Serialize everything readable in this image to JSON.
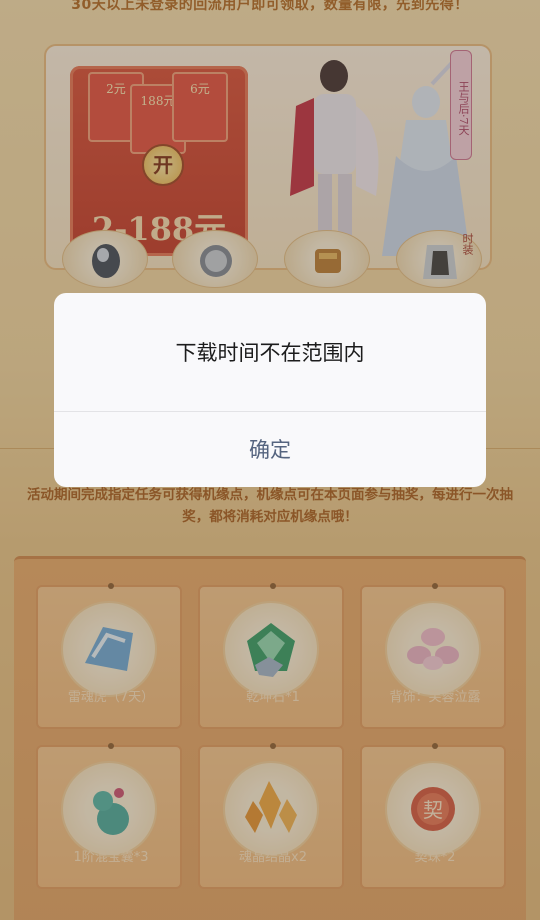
{
  "page": {
    "top_notice": "30天以上未登录的回流用户即可领取，数量有限，先到先得！",
    "banner": {
      "cards": [
        "2元",
        "188元",
        "6元"
      ],
      "open_label": "开",
      "amount": "2-188元",
      "tag": "王与后·7天",
      "time_limited_label": "时装"
    },
    "description": "活动期间完成指定任务可获得机缘点，机缘点可在本页面参与抽奖，每进行一次抽奖，都将消耗对应机缘点哦！",
    "prizes": [
      {
        "name": "雷魂虎（7天）",
        "icon": "tiger-icon"
      },
      {
        "name": "乾坤石*1",
        "icon": "green-gem-icon"
      },
      {
        "name": "背饰：芙蓉泣露",
        "icon": "lotus-icon"
      },
      {
        "name": "1阶混宝囊*3",
        "icon": "gourd-icon"
      },
      {
        "name": "魂晶结晶x2",
        "icon": "crystal-icon"
      },
      {
        "name": "契珠*2",
        "icon": "contract-orb-icon"
      }
    ]
  },
  "dialog": {
    "message": "下载时间不在范围内",
    "confirm_label": "确定"
  },
  "colors": {
    "dialog_bg": "#f9f9fb",
    "button_text": "#55647f",
    "page_accent": "#a65a19"
  }
}
